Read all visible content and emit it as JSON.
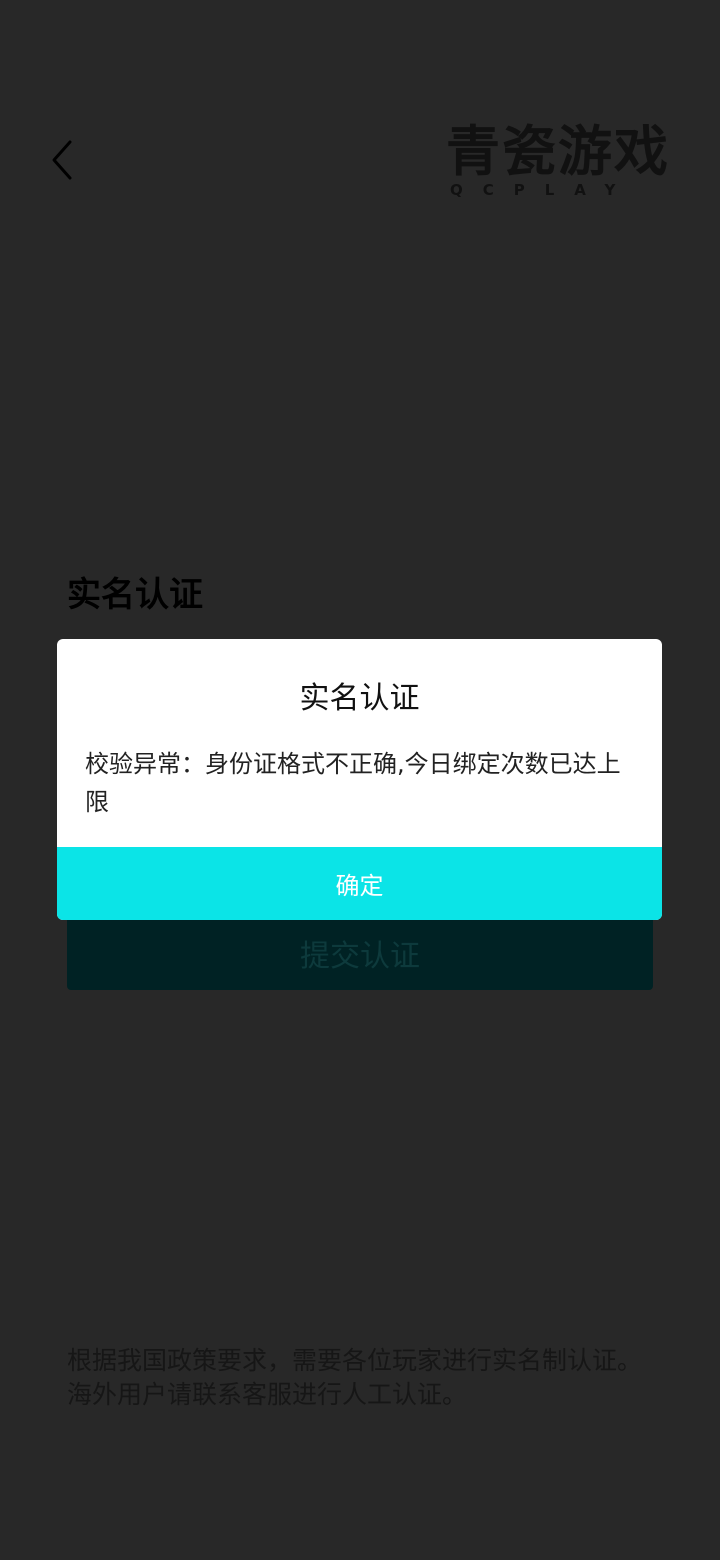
{
  "header": {
    "back_icon": "chevron-left-icon",
    "logo_main": "青瓷游戏",
    "logo_sub": "QCPLAY"
  },
  "page": {
    "title": "实名认证",
    "submit_label": "提交认证",
    "notice_line1": "根据我国政策要求，需要各位玩家进行实名制认证。",
    "notice_line2": "海外用户请联系客服进行人工认证。"
  },
  "dialog": {
    "title": "实名认证",
    "message": "校验异常：身份证格式不正确,今日绑定次数已达上限",
    "confirm_label": "确定"
  },
  "colors": {
    "background": "#282828",
    "accent": "#0be4e7",
    "submit_bg": "#002224"
  }
}
